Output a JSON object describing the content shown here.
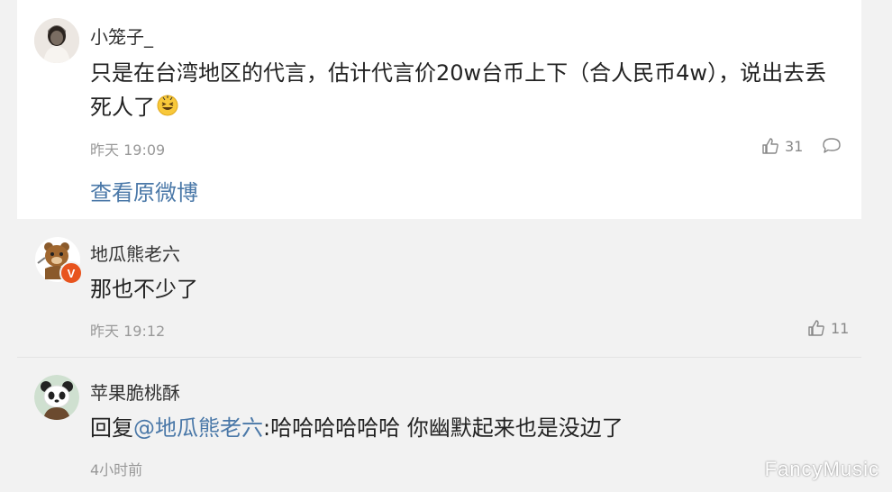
{
  "post": {
    "username": "小笼子_",
    "text": "只是在台湾地区的代言，估计代言价20w台币上下（合人民币4w），说出去丢死人了",
    "emoji_icon": "grin-squint-face-icon",
    "time": "昨天 19:09",
    "likes": "31",
    "view_original": "查看原微博"
  },
  "replies": [
    {
      "username": "地瓜熊老六",
      "text": "那也不少了",
      "time": "昨天 19:12",
      "likes": "11",
      "badge_icon": "verified-v-badge-icon"
    },
    {
      "username": "苹果脆桃酥",
      "reply_prefix": "回复",
      "mention": "@地瓜熊老六",
      "text": ":哈哈哈哈哈哈 你幽默起来也是没边了",
      "time": "4小时前"
    }
  ],
  "watermark": "FancyMusic",
  "colors": {
    "link": "#4a78a8",
    "badge": "#e8541e",
    "page_bg": "#f2f2f2",
    "card_bg": "#ffffff"
  }
}
